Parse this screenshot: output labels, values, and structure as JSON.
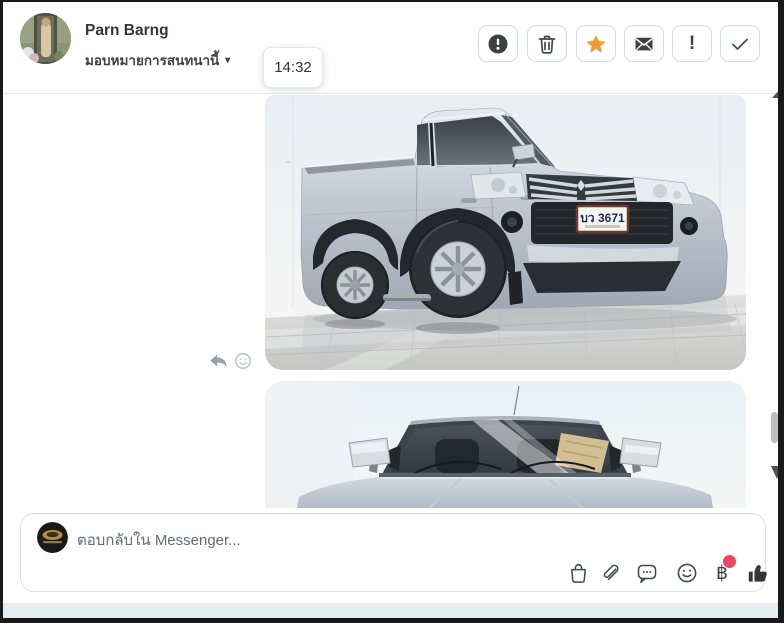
{
  "header": {
    "contact_name": "Parn Barng",
    "conversation_action": "มอบหมายการสนทนานี้",
    "caret": "▾",
    "time_tooltip": "14:32",
    "action_buttons": [
      {
        "name": "report",
        "icon": "alert-circle-icon"
      },
      {
        "name": "delete",
        "icon": "trash-icon"
      },
      {
        "name": "flag-follow-up",
        "icon": "star-icon",
        "active_color": "#F09B38"
      },
      {
        "name": "mark-as-unread",
        "icon": "envelope-icon"
      },
      {
        "name": "mark-important",
        "icon": "exclamation-icon",
        "text": "!"
      },
      {
        "name": "mark-as-done",
        "icon": "check-icon"
      }
    ]
  },
  "chat": {
    "messages": [
      {
        "type": "image",
        "alt": "Silver Mitsubishi pickup truck, front three-quarter view in white showroom with glossy tiled floor",
        "license_plate": "บว 3671"
      },
      {
        "type": "image",
        "alt": "Silver pickup truck front view with windshield and mirrors, partially visible"
      }
    ],
    "hover_actions": [
      "reply",
      "react-emoji"
    ]
  },
  "composer": {
    "placeholder": "ตอบกลับใน Messenger...",
    "tools": [
      {
        "name": "shopping-bag"
      },
      {
        "name": "attachment"
      },
      {
        "name": "comment"
      },
      {
        "name": "emoji"
      },
      {
        "name": "payment-baht",
        "symbol": "฿",
        "has_notification": true
      },
      {
        "name": "like-thumbs-up"
      }
    ]
  },
  "colors": {
    "star_active": "#F09B38",
    "notification_dot": "#F04660",
    "footer_strip": "#E3EDF2",
    "icon_dark": "#3E4348",
    "window_border": "#1A1A1A"
  }
}
